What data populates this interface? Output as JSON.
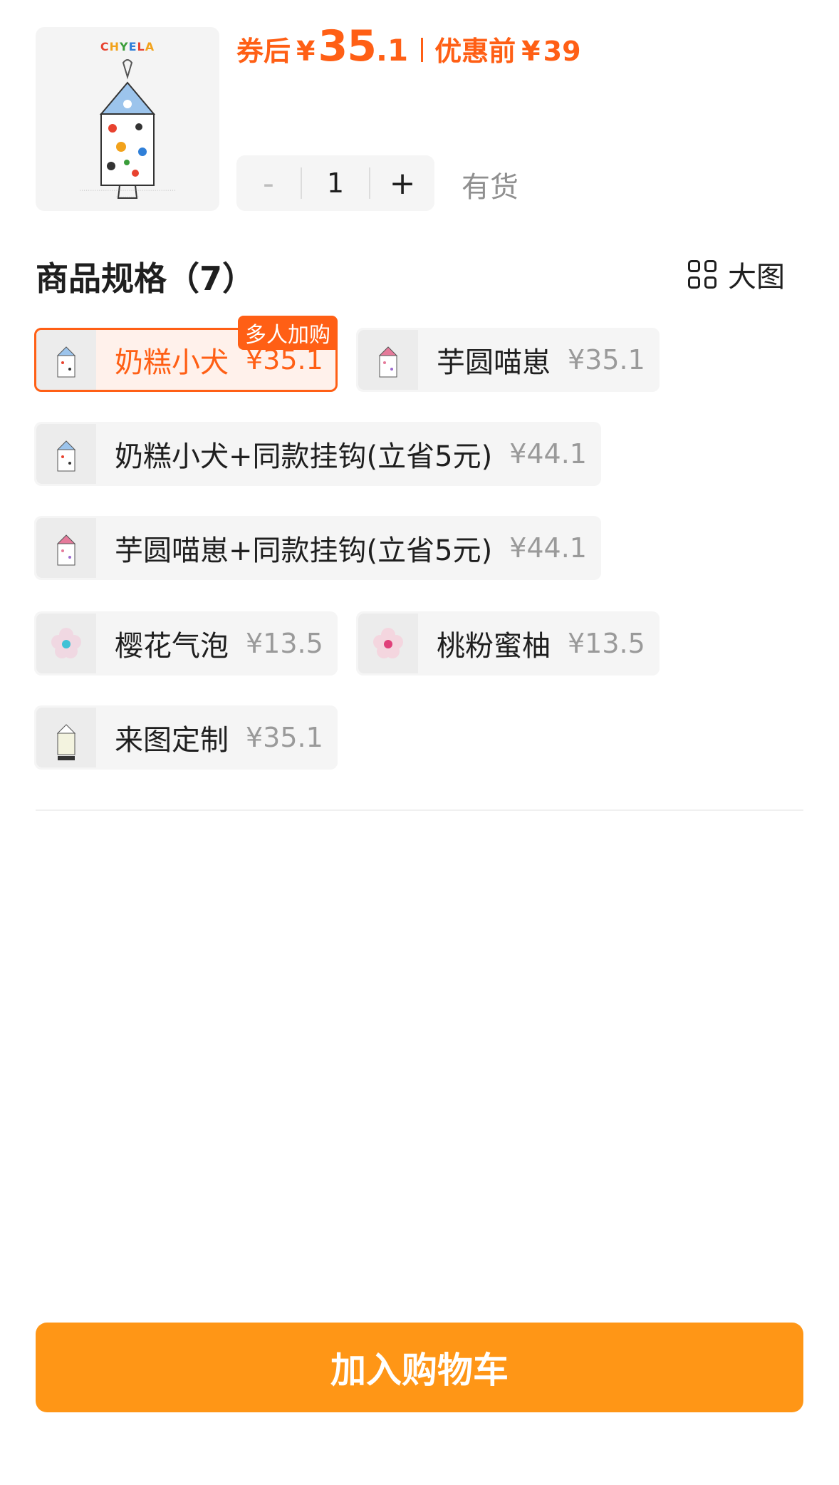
{
  "colors": {
    "accent": "#ff5f15",
    "cta": "#ff9616",
    "muted": "#9a9a9a"
  },
  "product": {
    "brand": "CHYELA",
    "brand_letter_colors": [
      "#e8422f",
      "#f2a21b",
      "#3a9d3a",
      "#2f7fd8",
      "#e8422f",
      "#f2a21b"
    ]
  },
  "price": {
    "after_coupon_label": "券后",
    "currency": "¥",
    "after_coupon_int": "35",
    "after_coupon_dec": ".1",
    "before_label": "优惠前",
    "before_value": "39"
  },
  "stepper": {
    "minus": "-",
    "quantity": "1",
    "plus": "+"
  },
  "stock_status": "有货",
  "specs": {
    "title": "商品规格（7）",
    "view_label": "大图",
    "options": [
      {
        "name": "奶糕小犬",
        "price": "¥35.1",
        "tag": "多人加购",
        "selected": true,
        "thumb": "dog"
      },
      {
        "name": "芋圆喵崽",
        "price": "¥35.1",
        "thumb": "cat"
      },
      {
        "name": "奶糕小犬+同款挂钩(立省5元)",
        "price": "¥44.1",
        "thumb": "dog"
      },
      {
        "name": "芋圆喵崽+同款挂钩(立省5元)",
        "price": "¥44.1",
        "thumb": "cat"
      },
      {
        "name": "樱花气泡",
        "price": "¥13.5",
        "thumb": "flower-blue"
      },
      {
        "name": "桃粉蜜柚",
        "price": "¥13.5",
        "thumb": "flower-pink"
      },
      {
        "name": "来图定制",
        "price": "¥35.1",
        "thumb": "custom"
      }
    ]
  },
  "cart_button": "加入购物车"
}
